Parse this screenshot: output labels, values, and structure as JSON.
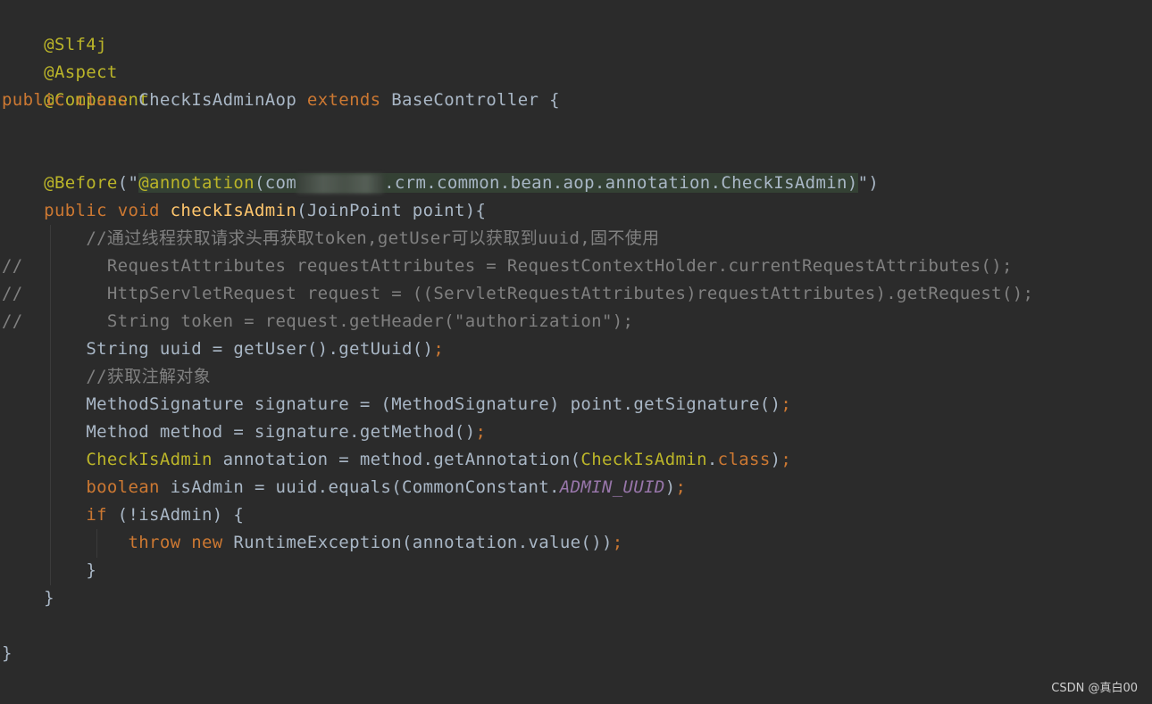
{
  "code": {
    "slf4j": "@Slf4j",
    "aspect": "@Aspect",
    "component": "@Component",
    "kw_public": "public",
    "kw_class": "class",
    "class_name": "CheckIsAdminAop",
    "kw_extends": "extends",
    "base_class": "BaseController",
    "open_brace": " {",
    "before_annot": "@Before",
    "paren_quote_open": "(\"",
    "annotation_kw": "@annotation",
    "pkg_start": "(com",
    "pkg_rest": ".crm.common.bean.aop.annotation.CheckIsAdmin)",
    "quote_paren_close": "\")",
    "kw_void": "void",
    "method_name": "checkIsAdmin",
    "params": "(JoinPoint point){",
    "comment1": "//通过线程获取请求头再获取token,getUser可以获取到uuid,固不使用",
    "commented1": "//        RequestAttributes requestAttributes = RequestContextHolder.currentRequestAttributes();",
    "commented2": "//        HttpServletRequest request = ((ServletRequestAttributes)requestAttributes).getRequest();",
    "commented3": "//        String token = request.getHeader(\"authorization\");",
    "uuid_line": "String uuid = getUser().getUuid()",
    "semicolon": ";",
    "comment2": "//获取注解对象",
    "signature_line": "MethodSignature signature = (MethodSignature) point.getSignature()",
    "method_line": "Method method = signature.getMethod()",
    "checkisadmin_type": "CheckIsAdmin",
    "annotation_mid": " annotation = method.getAnnotation(",
    "class_ref": "CheckIsAdmin",
    "dot": ".",
    "kw_class_ref": "class",
    "close_paren": ")",
    "kw_boolean": "boolean",
    "isadmin_mid": " isAdmin = uuid.equals(CommonConstant.",
    "admin_uuid": "ADMIN_UUID",
    "kw_if": "if",
    "if_cond": " (!isAdmin) {",
    "kw_throw": "throw",
    "kw_new": "new",
    "exception_call": "RuntimeException(annotation.value())",
    "close_if": "}",
    "close_method": "}",
    "close_class": "}"
  },
  "watermark": "CSDN @真白00"
}
